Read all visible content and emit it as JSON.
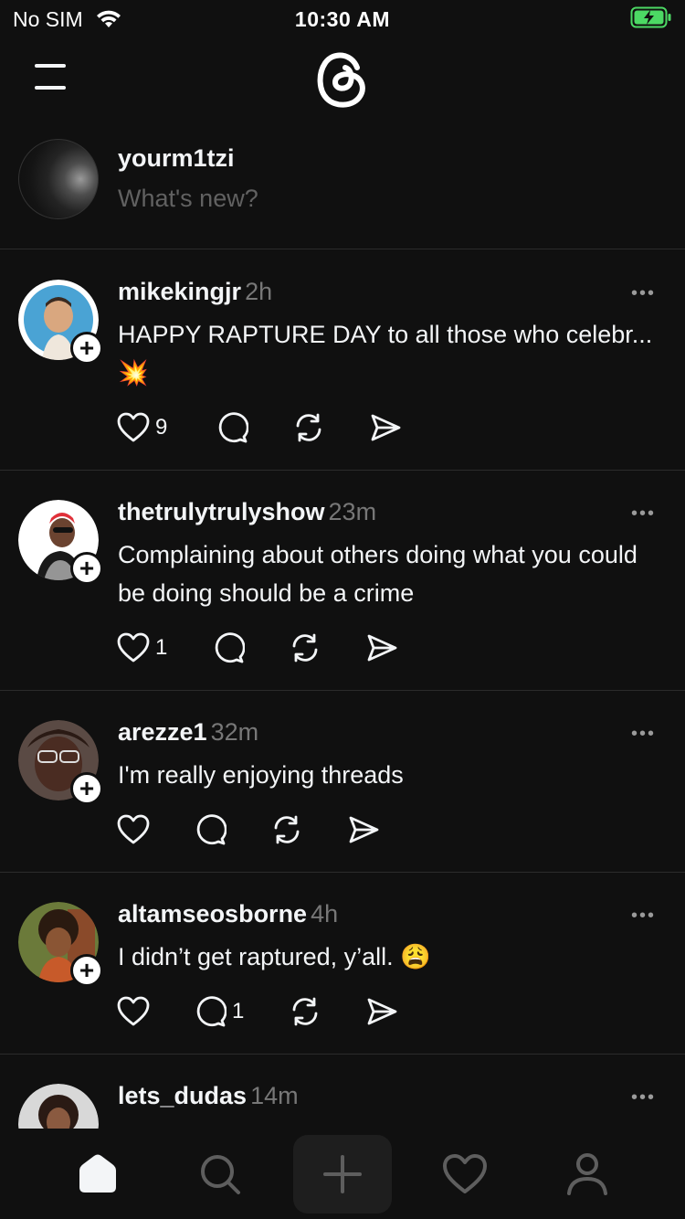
{
  "status_bar": {
    "carrier": "No SIM",
    "time": "10:30 AM"
  },
  "composer": {
    "username": "yourm1tzi",
    "placeholder": "What's new?"
  },
  "posts": [
    {
      "username": "mikekingjr",
      "time": "2h",
      "text": "HAPPY RAPTURE DAY to all those who celebr... 💥",
      "likes": "9",
      "replies": ""
    },
    {
      "username": "thetrulytrulyshow",
      "time": "23m",
      "text": "Complaining about others doing what you could be doing should be a crime",
      "likes": "1",
      "replies": ""
    },
    {
      "username": "arezze1",
      "time": "32m",
      "text": "I'm really enjoying threads",
      "likes": "",
      "replies": ""
    },
    {
      "username": "altamseosborne",
      "time": "4h",
      "text": "I didn’t get raptured, y’all. 😩",
      "likes": "",
      "replies": "1"
    },
    {
      "username": "lets_dudas",
      "time": "14m",
      "text": "",
      "likes": "",
      "replies": ""
    }
  ],
  "more_label": "•••",
  "follow_label": "+",
  "colors": {
    "background": "#101010",
    "text": "#f3f5f7",
    "secondary": "#777777",
    "divider": "#2b2b2b",
    "battery": "#4cd964"
  },
  "icons": [
    "menu-icon",
    "threads-logo-icon",
    "heart-icon",
    "comment-icon",
    "repost-icon",
    "share-icon",
    "home-icon",
    "search-icon",
    "compose-icon",
    "activity-icon",
    "profile-icon"
  ]
}
